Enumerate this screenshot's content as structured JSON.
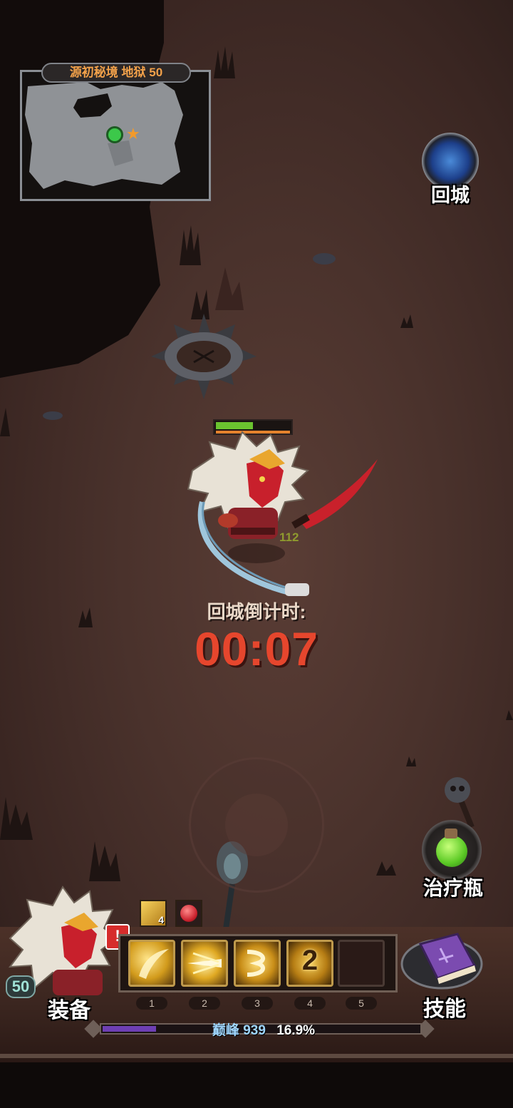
{
  "minimap": {
    "title": "源初秘境 地狱 50"
  },
  "return_town": {
    "label": "回城"
  },
  "player": {
    "hp_fraction": 0.5,
    "mp_fraction": 1.0,
    "damage_number": "112"
  },
  "countdown": {
    "label": "回城倒计时:",
    "time": "00:07"
  },
  "potion": {
    "label": "治疗瓶"
  },
  "buffs": [
    {
      "icon": "gold-wing-buff-icon",
      "stack": "4"
    },
    {
      "icon": "red-orb-buff-icon",
      "stack": ""
    }
  ],
  "character": {
    "level": "50",
    "equip_label": "装备",
    "alert": "!"
  },
  "skills": [
    {
      "key": "1",
      "icon": "golden-slash-icon",
      "badge": ""
    },
    {
      "key": "2",
      "icon": "golden-beam-icon",
      "badge": ""
    },
    {
      "key": "3",
      "icon": "golden-claw-icon",
      "badge": ""
    },
    {
      "key": "4",
      "icon": "golden-rune-icon",
      "badge": "2"
    },
    {
      "key": "5",
      "icon": "empty-slot-icon",
      "badge": ""
    }
  ],
  "skill_book": {
    "label": "技能"
  },
  "exp": {
    "rank": "巅峰",
    "points": "939",
    "percent": "16.9%",
    "fraction": 0.169
  },
  "colors": {
    "countdown": "#e6462d",
    "exp_fill": "#6e3fb3",
    "hp": "#6ac32f",
    "mp": "#e4822d"
  }
}
